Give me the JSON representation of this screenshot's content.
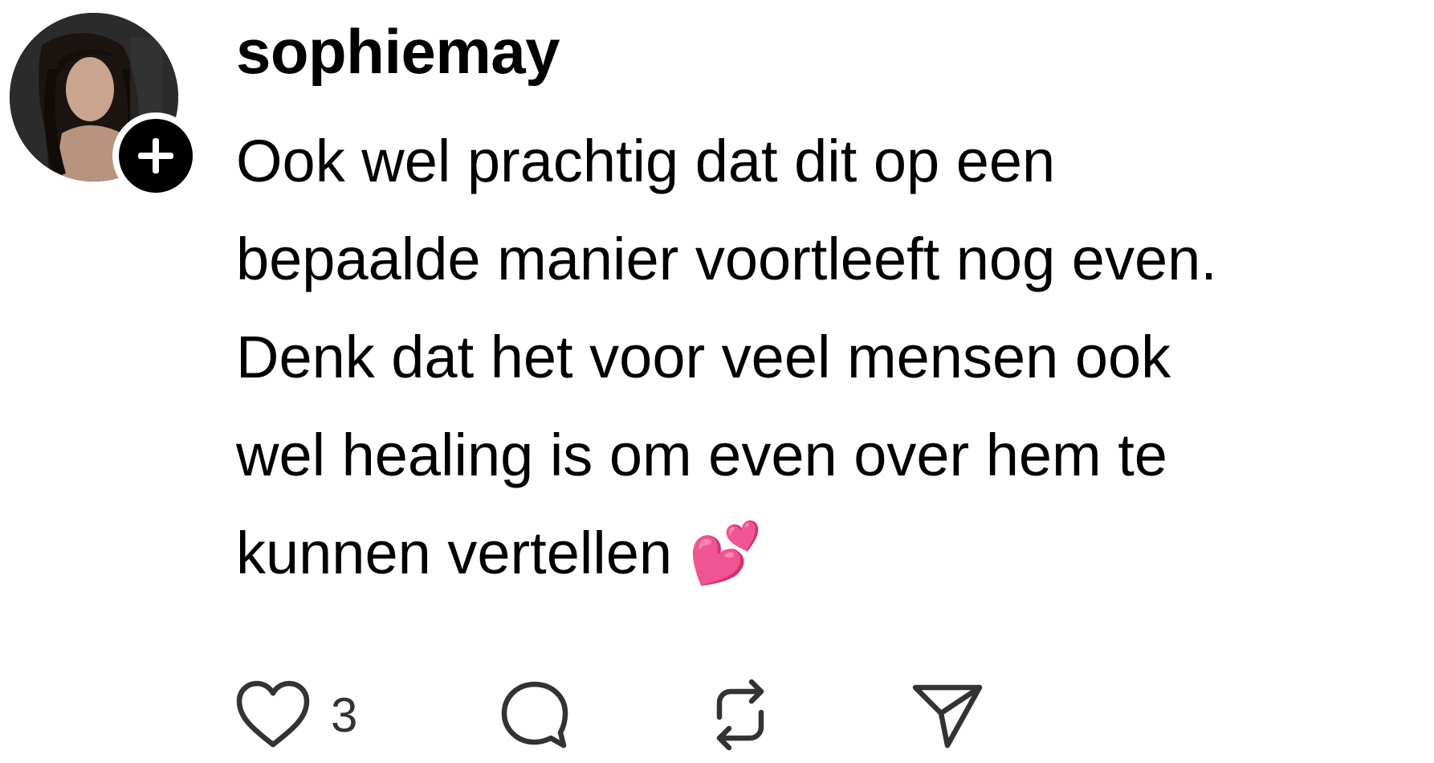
{
  "post": {
    "username": "sophiemay",
    "text_lines": [
      "Ook wel prachtig dat dit op een",
      "bepaalde manier voortleeft nog even.",
      "Denk dat het voor veel mensen ook",
      "wel healing is om even over hem te",
      "kunnen vertellen 💕"
    ],
    "like_count": "3"
  },
  "icons": {
    "avatar": "avatar-photo",
    "follow": "plus-icon",
    "like": "heart-icon",
    "comment": "comment-bubble-icon",
    "repost": "repost-icon",
    "share": "send-icon"
  },
  "colors": {
    "text": "#000000",
    "icon": "#333333",
    "badge": "#000000"
  }
}
